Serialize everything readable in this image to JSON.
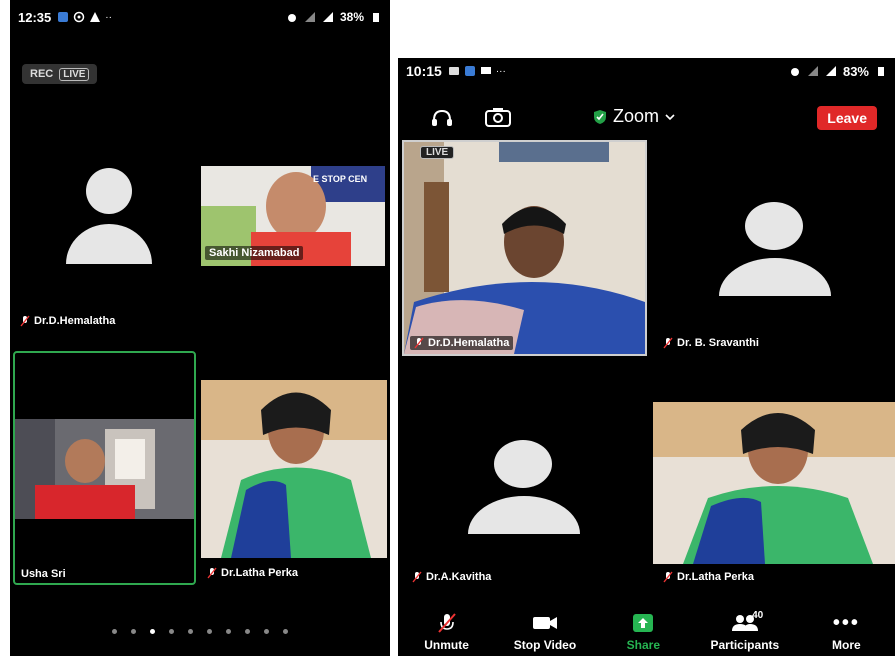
{
  "left_phone": {
    "status": {
      "time": "12:35",
      "battery": "38%"
    },
    "rec_label": "REC",
    "live_label": "LIVE",
    "tiles": {
      "hemalatha": {
        "name": "Dr.D.Hemalatha"
      },
      "sakhi": {
        "name": "Sakhi Nizamabad",
        "banner_text": "E STOP CEN"
      },
      "usha": {
        "name": "Usha Sri"
      },
      "latha": {
        "name": "Dr.Latha Perka"
      }
    },
    "page_dots": {
      "count": 10,
      "active_index": 2
    }
  },
  "right_phone": {
    "status": {
      "time": "10:15",
      "battery": "83%"
    },
    "app_title": "Zoom",
    "leave_label": "Leave",
    "live_label": "LIVE",
    "tiles": {
      "hemalatha": {
        "name": "Dr.D.Hemalatha"
      },
      "sravanthi": {
        "name": "Dr. B. Sravanthi"
      },
      "kavitha": {
        "name": "Dr.A.Kavitha"
      },
      "latha": {
        "name": "Dr.Latha Perka"
      }
    },
    "toolbar": {
      "unmute": "Unmute",
      "stop_video": "Stop Video",
      "share": "Share",
      "participants": "Participants",
      "participants_count": "40",
      "more": "More"
    }
  },
  "colors": {
    "leave_red": "#e02828",
    "active_speaker_green": "#2fa84f",
    "share_green": "#26b552",
    "shield_green": "#23a047"
  }
}
